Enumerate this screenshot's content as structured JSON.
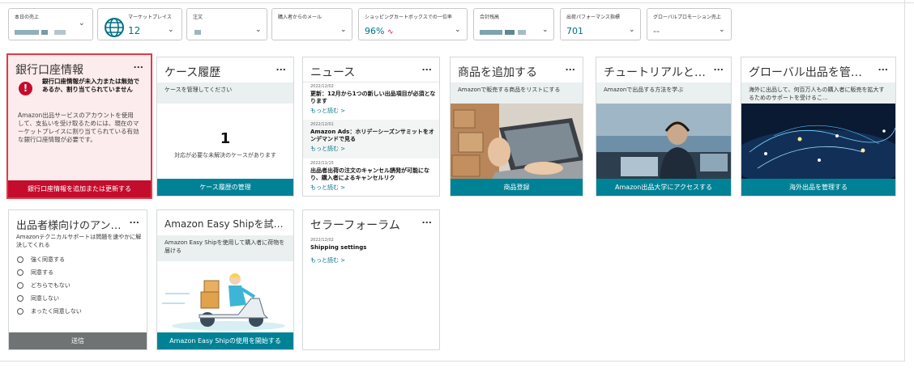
{
  "metrics": [
    {
      "label": "本日の売上",
      "value": ""
    },
    {
      "label": "マーケットプレイス",
      "value": "12"
    },
    {
      "label": "注文",
      "value": ""
    },
    {
      "label": "購入者からのメール",
      "value": ""
    },
    {
      "label": "ショッピングカートボックスでの一位率",
      "value": "96%"
    },
    {
      "label": "合計残高",
      "value": ""
    },
    {
      "label": "出荷パフォーマンス指標",
      "value": "701"
    },
    {
      "label": "グローバルプロモーション売上",
      "value": "--"
    }
  ],
  "cards": {
    "bank": {
      "title": "銀行口座情報",
      "more": "...",
      "alert": "銀行口座情報が未入力または無効であるか、割り当てられていません",
      "body": "Amazon出品サービスのアカウントを使用して、支払いを受け取るためには、現在のマーケットプレイスに割り当てられている有効な銀行口座情報が必要です。",
      "button": "銀行口座情報を追加または更新する"
    },
    "cases": {
      "title": "ケース履歴",
      "more": "...",
      "subtitle": "ケースを管理してください",
      "count": "1",
      "description": "対応が必要な未解決のケースがあります",
      "button": "ケース履歴の管理"
    },
    "news": {
      "title": "ニュース",
      "more": "...",
      "items": [
        {
          "date": "2022/12/02",
          "title": "更新：12月から1つの新しい出品項目が必須となります",
          "more": "もっと読む >"
        },
        {
          "date": "2022/12/01",
          "title": "Amazon Ads：ホリデーシーズンサミットをオンデマンドで見る",
          "more": "もっと読む >"
        },
        {
          "date": "2022/11/15",
          "title": "出品者出荷の注文のキャンセル誘発が可能になり、購入者によるキャンセルリク",
          "more": "もっと読む >"
        }
      ]
    },
    "add_product": {
      "title": "商品を追加する",
      "more": "...",
      "subtitle": "Amazonで販売する商品をリストにする",
      "button": "商品登録"
    },
    "tutorial": {
      "title": "チュートリアルとトレ...",
      "more": "...",
      "subtitle": "Amazonで出品する方法を学ぶ",
      "button": "Amazon出品大学にアクセスする"
    },
    "global": {
      "title": "グローバル出品を管理...",
      "more": "...",
      "subtitle": "海外に出品して、何百万人もの購入者に販売を拡大するためのサポートを受けるこ...",
      "button": "海外出品を管理する"
    },
    "survey": {
      "title": "出品者様向けのアンケ...",
      "more": "...",
      "intro": "Amazonテクニカルサポートは問題を速やかに解決してくれる",
      "options": [
        "強く同意する",
        "同意する",
        "どちらでもない",
        "同意しない",
        "まったく同意しない"
      ],
      "button": "送信"
    },
    "easyship": {
      "title": "Amazon Easy Shipを試す...",
      "subtitle": "Amazon Easy Shipを使用して購入者に荷物を届ける",
      "button": "Amazon Easy Shipの使用を開始する"
    },
    "forum": {
      "title": "セラーフォーラム",
      "more": "...",
      "date": "2022/12/02",
      "post": "Shipping settings",
      "more_link": "もっと読む >"
    }
  },
  "colors": {
    "accent": "#008296",
    "alert": "#c40c2c",
    "link": "#007185"
  }
}
